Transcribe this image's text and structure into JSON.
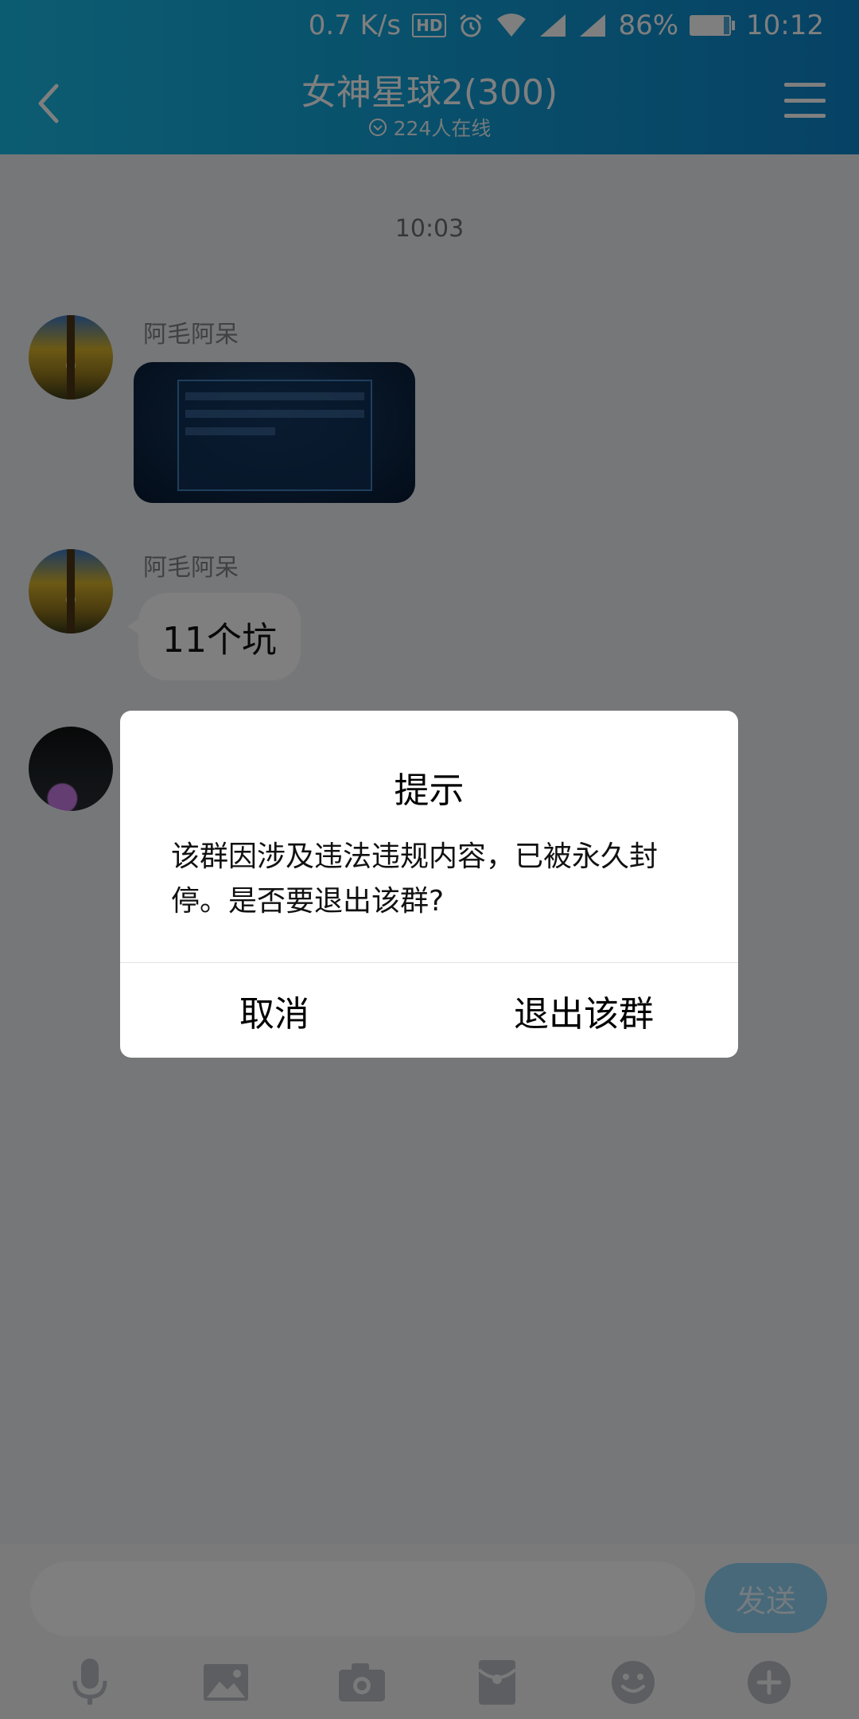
{
  "status_bar": {
    "speed": "0.7 K/s",
    "hd_badge": "HD",
    "battery_percent": "86%",
    "battery_level": 0.86,
    "time": "10:12"
  },
  "header": {
    "title": "女神星球2(300)",
    "online": "224人在线"
  },
  "chat": {
    "timestamp": "10:03",
    "messages": [
      {
        "sender": "阿毛阿呆",
        "type": "image"
      },
      {
        "sender": "阿毛阿呆",
        "type": "text",
        "text": "11个坑"
      }
    ]
  },
  "input_bar": {
    "send_label": "发送",
    "tools": [
      "microphone-icon",
      "image-icon",
      "camera-icon",
      "red-packet-icon",
      "emoji-icon",
      "plus-icon"
    ]
  },
  "dialog": {
    "title": "提示",
    "message": "该群因涉及违法违规内容，已被永久封停。是否要退出该群?",
    "cancel_label": "取消",
    "confirm_label": "退出该群"
  },
  "colors": {
    "header_start": "#19b9e3",
    "header_end": "#0d84c9",
    "send_button": "#8fd3f4",
    "icon_gray": "#b9bcc3"
  }
}
